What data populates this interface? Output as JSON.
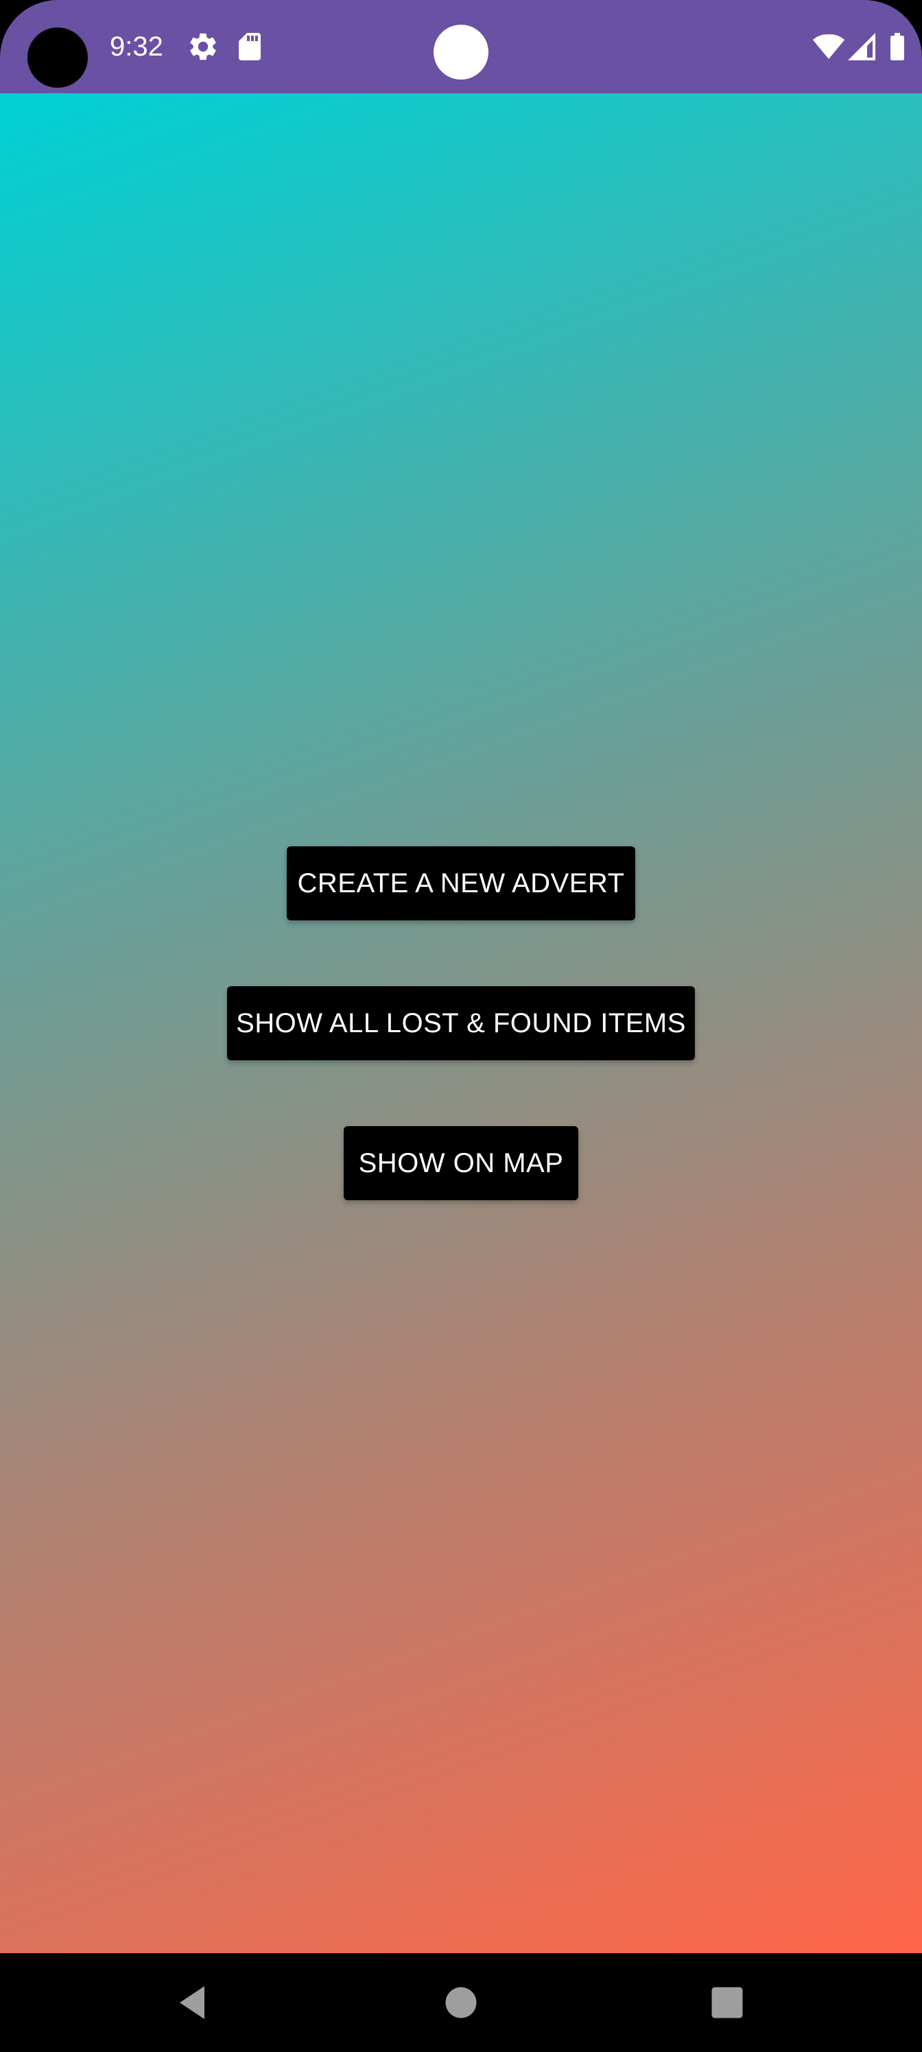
{
  "status_bar": {
    "time": "9:32",
    "icons": [
      "camera-hole",
      "settings-gear-icon",
      "sd-card-icon",
      "center-indicator",
      "wifi-icon",
      "signal-icon",
      "battery-icon"
    ],
    "background_color": "#6a51a3"
  },
  "main": {
    "background_gradient": [
      "#00d1d4",
      "#6a9f97",
      "#b48070",
      "#ff6548"
    ],
    "buttons": [
      {
        "label": "CREATE A NEW ADVERT"
      },
      {
        "label": "SHOW ALL LOST & FOUND ITEMS"
      },
      {
        "label": "SHOW ON MAP"
      }
    ]
  },
  "nav_bar": {
    "icons": [
      "back-icon",
      "home-icon",
      "recents-icon"
    ]
  }
}
